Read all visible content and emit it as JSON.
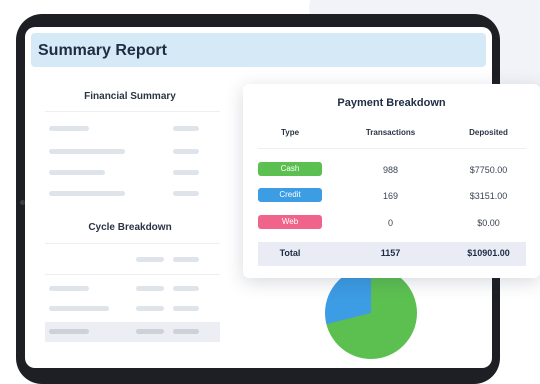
{
  "report": {
    "title": "Summary Report"
  },
  "panels": {
    "financial_summary_title": "Financial Summary",
    "cycle_breakdown_title": "Cycle Breakdown"
  },
  "payment_card": {
    "title": "Payment Breakdown",
    "columns": [
      "Type",
      "Transactions",
      "Deposited"
    ],
    "rows": [
      {
        "type": "Cash",
        "transactions": "988",
        "deposited": "$7750.00",
        "color": "#5cc051"
      },
      {
        "type": "Credit",
        "transactions": "169",
        "deposited": "$3151.00",
        "color": "#3c9ce4"
      },
      {
        "type": "Web",
        "transactions": "0",
        "deposited": "$0.00",
        "color": "#f0638b"
      }
    ],
    "total": {
      "label": "Total",
      "transactions": "1157",
      "deposited": "$10901.00"
    }
  },
  "pie": {
    "colors": [
      "#5cc051",
      "#3c9ce4"
    ]
  }
}
